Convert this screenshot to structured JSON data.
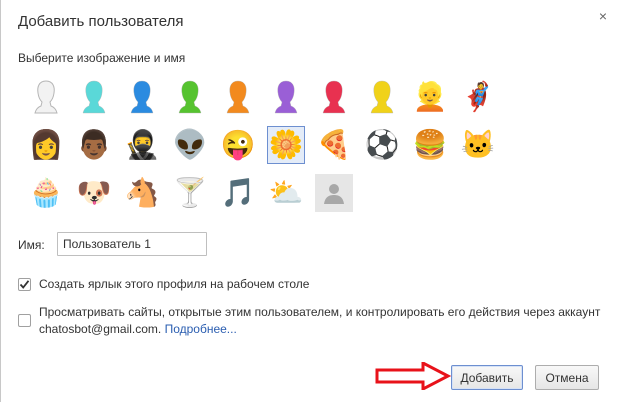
{
  "dialog": {
    "title": "Добавить пользователя",
    "close_glyph": "×",
    "subtitle": "Выберите изображение и имя"
  },
  "avatars": [
    {
      "name": "avatar-generic-white",
      "kind": "silhouette",
      "color": "#f2f2f2"
    },
    {
      "name": "avatar-generic-cyan",
      "kind": "silhouette",
      "color": "#5ad8d8"
    },
    {
      "name": "avatar-generic-blue",
      "kind": "silhouette",
      "color": "#2b8be0"
    },
    {
      "name": "avatar-generic-green",
      "kind": "silhouette",
      "color": "#56c330"
    },
    {
      "name": "avatar-generic-orange",
      "kind": "silhouette",
      "color": "#f28a1e"
    },
    {
      "name": "avatar-generic-purple",
      "kind": "silhouette",
      "color": "#9a5fd6"
    },
    {
      "name": "avatar-generic-red",
      "kind": "silhouette",
      "color": "#e83150"
    },
    {
      "name": "avatar-generic-yellow",
      "kind": "silhouette",
      "color": "#f0d21a"
    },
    {
      "name": "avatar-businessman",
      "kind": "emoji",
      "glyph": "👱"
    },
    {
      "name": "avatar-ninja-mask",
      "kind": "emoji",
      "glyph": "🦸"
    },
    {
      "name": "avatar-businesswoman",
      "kind": "emoji",
      "glyph": "👩"
    },
    {
      "name": "avatar-man-dark",
      "kind": "emoji",
      "glyph": "👨🏾"
    },
    {
      "name": "avatar-ninja",
      "kind": "emoji",
      "glyph": "🥷"
    },
    {
      "name": "avatar-alien",
      "kind": "emoji",
      "glyph": "👽"
    },
    {
      "name": "avatar-smiley",
      "kind": "emoji",
      "glyph": "😜"
    },
    {
      "name": "avatar-flower",
      "kind": "emoji",
      "glyph": "🌼",
      "selected": true
    },
    {
      "name": "avatar-pizza",
      "kind": "emoji",
      "glyph": "🍕"
    },
    {
      "name": "avatar-soccer-ball",
      "kind": "emoji",
      "glyph": "⚽"
    },
    {
      "name": "avatar-hamburger",
      "kind": "emoji",
      "glyph": "🍔"
    },
    {
      "name": "avatar-cat",
      "kind": "emoji",
      "glyph": "🐱"
    },
    {
      "name": "avatar-cupcake",
      "kind": "emoji",
      "glyph": "🧁"
    },
    {
      "name": "avatar-dog",
      "kind": "emoji",
      "glyph": "🐶"
    },
    {
      "name": "avatar-horse",
      "kind": "emoji",
      "glyph": "🐴"
    },
    {
      "name": "avatar-cocktail",
      "kind": "emoji",
      "glyph": "🍸"
    },
    {
      "name": "avatar-music-note",
      "kind": "emoji",
      "glyph": "🎵"
    },
    {
      "name": "avatar-sun-cloud",
      "kind": "emoji",
      "glyph": "⛅"
    },
    {
      "name": "avatar-placeholder-photo",
      "kind": "placeholder"
    }
  ],
  "name_field": {
    "label": "Имя:",
    "value": "Пользователь 1"
  },
  "shortcut": {
    "checked": true,
    "label": "Создать ярлык этого профиля на рабочем столе"
  },
  "supervise": {
    "checked": false,
    "line1": "Просматривать сайты, открытые этим пользователем, и контролировать его действия через аккаунт",
    "email": "chatosbot@gmail.com.",
    "link": "Подробнее..."
  },
  "buttons": {
    "add": "Добавить",
    "cancel": "Отмена"
  },
  "colors": {
    "selection_border": "#6d8fd0",
    "link": "#2a5db0",
    "annotation_arrow": "#e8121a"
  }
}
